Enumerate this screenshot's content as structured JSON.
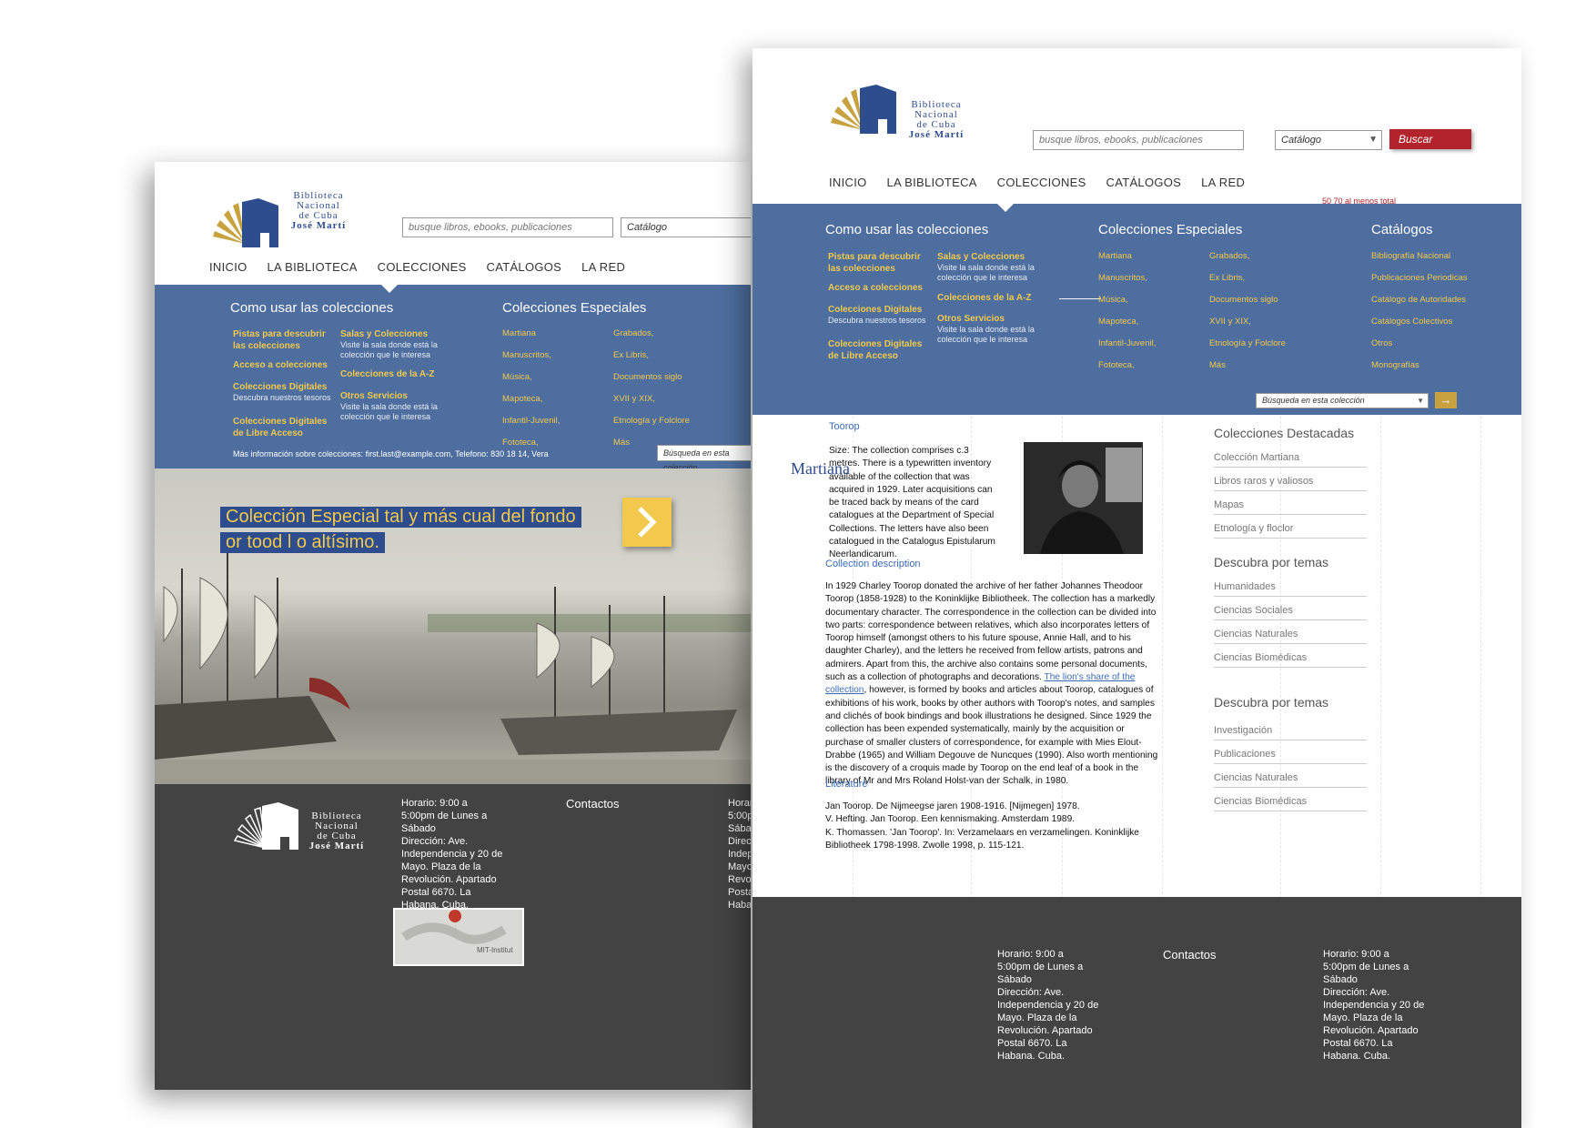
{
  "logo": {
    "line1": "Biblioteca",
    "line2": "Nacional",
    "line3": "de Cuba",
    "line4": "José Martí"
  },
  "search": {
    "placeholder": "busque libros, ebooks, publicaciones",
    "select": "Catálogo",
    "button": "Buscar"
  },
  "nav": {
    "items": [
      "INICIO",
      "LA BIBLIOTECA",
      "COLECCIONES",
      "CATÁLOGOS",
      "LA RED"
    ]
  },
  "mega": {
    "col1_title": "Como usar las colecciones",
    "pistas": "Pistas para descubrir las colecciones",
    "acceso": "Acceso a colecciones",
    "digitales": "Colecciones Digitales",
    "digitales_sub": "Descubra nuestros tesoros",
    "libre": "Colecciones Digitales de Libre Acceso",
    "salas": "Salas y Colecciones",
    "salas_sub": "Visite la sala donde está la colección que le interesa",
    "az": "Colecciones de la A-Z",
    "otros": "Otros Servicios",
    "otros_sub": "Visite la sala donde está la colección que le interesa",
    "col2_title": "Colecciones Especiales",
    "esp_a": [
      "Martiana",
      "Manuscritos,",
      "Música,",
      "Mapoteca,",
      "Infantil-Juvenil,",
      "Fototeca,"
    ],
    "esp_b": [
      "Grabados,",
      "Ex Libris,",
      "Documentos siglo",
      "XVII y XIX,",
      "Etnología y Folclore",
      "Más"
    ],
    "col3_title": "Catálogos",
    "cat": [
      "Bibliografía Nacional",
      "Publicaciones Periodicas",
      "Catálogo de Autoridades",
      "Catálogos Colectivos",
      "Otros",
      "Monografías"
    ],
    "more_info": "Más información sobre colecciones: first.last@example.com, Telefono: 830 18 14, Vera",
    "search_coll": "Búsqueda en esta colección",
    "red_note": "50 70 al menos total"
  },
  "hero": {
    "line1": "Colección Especial tal y más cual del fondo",
    "line2": "or tood l o altísimo."
  },
  "footer": {
    "horario": "Horario: 9:00 a 5:00pm de Lunes a Sábado",
    "direccion": "Dirección: Ave. Independencia y 20 de Mayo. Plaza de la Revolución. Apartado Postal 6670. La Habana. Cuba.",
    "contactos": "Contactos",
    "map_label": "MIT-Institut"
  },
  "article": {
    "breadcrumb": "Toorop",
    "overlay": "Martiana",
    "size": "Size: The collection comprises c.3 metres. There is a typewritten inventory available of the collection that was acquired in 1929. Later acquisitions can be traced back by means of the card catalogues at the Department of Special Collections. The letters have also been catalogued in the Catalogus Epistularum Neerlandicarum.",
    "desc_h": "Collection description",
    "desc_1": "In 1929 Charley Toorop donated the archive of her father Johannes Theodoor Toorop (1858-1928) to the Koninklijke Bibliotheek. The collection has a markedly documentary character. The correspondence in the collection can be divided into two parts: correspondence between relatives, which also incorporates letters of Toorop himself (amongst others to his future spouse, Annie Hall, and to his daughter Charley), and the letters he received from fellow artists, patrons and admirers. Apart from this, the archive also contains some personal documents, such as a collection of photographs and decorations.",
    "desc_link": "The lion's share of the collection",
    "desc_2": ", however, is formed by books and articles about Toorop, catalogues of exhibitions of his work, books by other authors with Toorop's notes, and samples and clichés of book bindings and book illustrations he designed. Since 1929 the collection has been expended systematically, mainly by the acquisition or purchase of smaller clusters of correspondence, for example with Mies Elout-Drabbe (1965) and William Degouve de Nuncques (1990). Also worth mentioning is the discovery of a croquis made by Toorop on the end leaf of a book in the library of Mr and Mrs Roland Holst-van der Schalk, in 1980.",
    "lit_h": "Literature",
    "lit": [
      "Jan Toorop. De Nijmeegse jaren 1908-1916. [Nijmegen] 1978.",
      "V. Hefting. Jan Toorop. Een kennismaking. Amsterdam 1989.",
      "K. Thomassen. 'Jan Toorop'. In: Verzamelaars en verzamelingen. Koninklijke Bibliotheek 1798-1998. Zwolle 1998, p. 115-121."
    ]
  },
  "sidebar": {
    "h1": "Colecciones Destacadas",
    "s1": [
      "Colección Martiana",
      "Libros raros y valiosos",
      "Mapas",
      "Etnología y floclor"
    ],
    "h2": "Descubra por temas",
    "s2": [
      "Humanidades",
      "Ciencias Sociales",
      "Ciencias Naturales",
      "Ciencias Biomédicas"
    ],
    "h3": "Descubra por temas",
    "s3": [
      "Investigación",
      "Publicaciones",
      "Ciencias Naturales",
      "Ciencias Biomédicas"
    ]
  },
  "colors": {
    "brand_blue": "#4d6e9f",
    "logo_blue": "#2e4d8f",
    "gold": "#f2c94c",
    "red_button": "#b3232b",
    "footer_dark": "#434343"
  }
}
